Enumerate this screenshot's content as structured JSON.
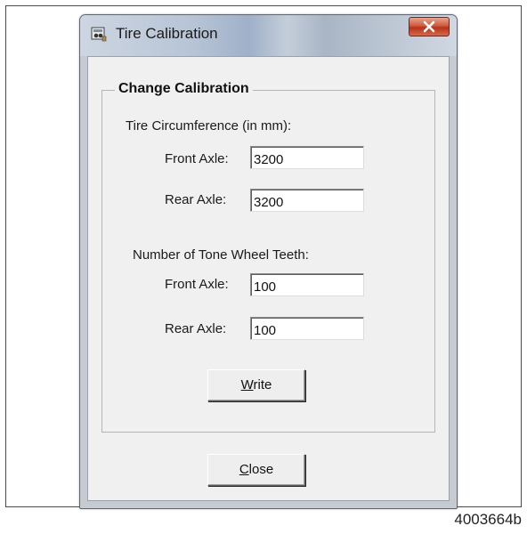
{
  "window": {
    "title": "Tire Calibration",
    "close_glyph": "x"
  },
  "group": {
    "title": "Change Calibration"
  },
  "circumference": {
    "heading": "Tire Circumference (in mm):",
    "front_label": "Front Axle:",
    "front_value": "3200",
    "rear_label": "Rear Axle:",
    "rear_value": "3200"
  },
  "tone_wheel": {
    "heading": "Number of Tone Wheel Teeth:",
    "front_label": "Front Axle:",
    "front_value": "100",
    "rear_label": "Rear Axle:",
    "rear_value": "100"
  },
  "buttons": {
    "write_mnemonic": "W",
    "write_rest": "rite",
    "close_mnemonic": "C",
    "close_rest": "lose"
  },
  "figure_id": "4003664b",
  "icons": {
    "app": "tire-app-icon",
    "close": "close-icon"
  }
}
